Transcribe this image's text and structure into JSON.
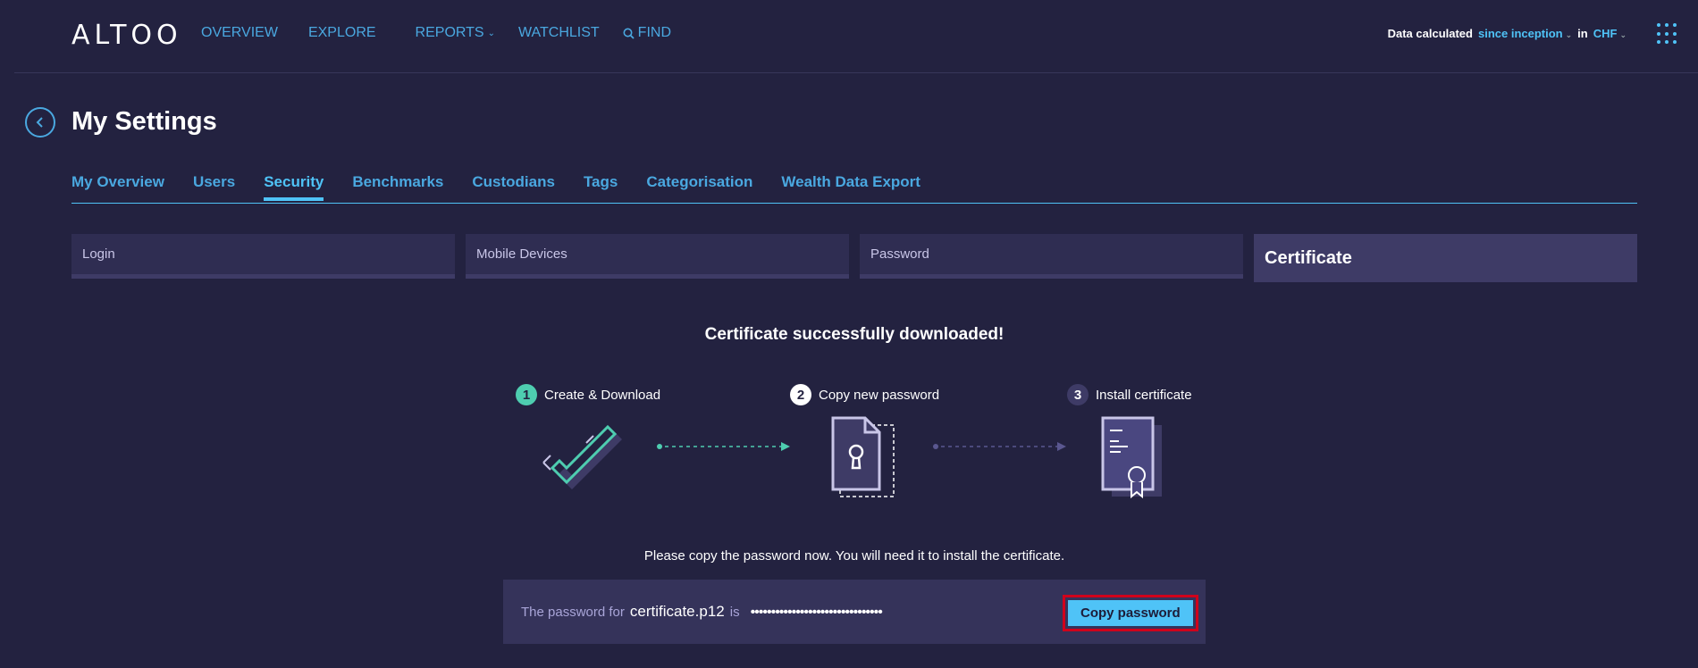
{
  "app": {
    "logo": "ALTOO"
  },
  "nav": {
    "overview": "OVERVIEW",
    "explore": "EXPLORE",
    "reports": "REPORTS",
    "watchlist": "WATCHLIST",
    "find": "FIND"
  },
  "header_right": {
    "prefix": "Data calculated",
    "period": "since inception",
    "in": "in",
    "currency": "CHF"
  },
  "page": {
    "title": "My Settings"
  },
  "tabs": [
    {
      "label": "My Overview"
    },
    {
      "label": "Users"
    },
    {
      "label": "Security"
    },
    {
      "label": "Benchmarks"
    },
    {
      "label": "Custodians"
    },
    {
      "label": "Tags"
    },
    {
      "label": "Categorisation"
    },
    {
      "label": "Wealth Data Export"
    }
  ],
  "active_tab": "Security",
  "subtabs": [
    {
      "label": "Login"
    },
    {
      "label": "Mobile Devices"
    },
    {
      "label": "Password"
    },
    {
      "label": "Certificate"
    }
  ],
  "active_subtab": "Certificate",
  "content": {
    "title": "Certificate successfully downloaded!",
    "steps": [
      {
        "num": "1",
        "label": "Create & Download",
        "state": "done"
      },
      {
        "num": "2",
        "label": "Copy new password",
        "state": "current"
      },
      {
        "num": "3",
        "label": "Install certificate",
        "state": "pending"
      }
    ],
    "instruction": "Please copy the password now. You will need it to install the certificate.",
    "password_prefix": "The password for",
    "filename": "certificate.p12",
    "password_is": "is",
    "password_masked": "••••••••••••••••••••••••••••••••",
    "copy_button": "Copy password"
  },
  "colors": {
    "background": "#232240",
    "accent": "#4fc3f7",
    "success": "#4ecdb0",
    "highlight": "#d0021b"
  }
}
